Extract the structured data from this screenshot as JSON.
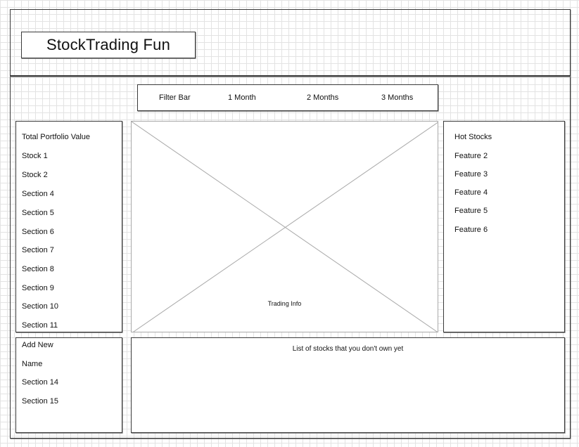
{
  "header": {
    "title": "StockTrading Fun"
  },
  "filter_bar": {
    "label": "Filter Bar",
    "options": [
      "1 Month",
      "2 Months",
      "3 Months"
    ]
  },
  "left_panel": {
    "items": [
      "Total Portfolio Value",
      "Stock 1",
      "Stock 2",
      "Section 4",
      "Section 5",
      "Section 6",
      "Section 7",
      "Section 8",
      "Section 9",
      "Section 10",
      "Section 11"
    ]
  },
  "left_bottom_panel": {
    "items": [
      "Add New",
      "Name",
      "Section 14",
      "Section 15"
    ]
  },
  "main_image": {
    "caption": "Trading Info",
    "icon": "image-placeholder-icon"
  },
  "right_panel": {
    "items": [
      "Hot Stocks",
      "Feature 2",
      "Feature 3",
      "Feature 4",
      "Feature 5",
      "Feature 6"
    ]
  },
  "stocks_list": {
    "caption": "List of stocks that you don't own yet"
  },
  "colors": {
    "stroke": "#3a3a3a",
    "grid": "#e3e3e3",
    "placeholder_line": "#a9a9a9"
  }
}
